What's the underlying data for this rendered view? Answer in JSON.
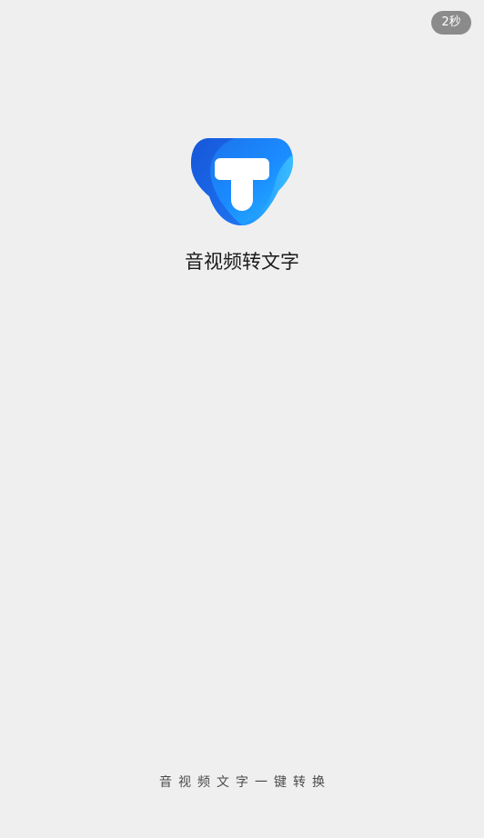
{
  "splash": {
    "skip_countdown": "2秒",
    "app_name": "音视频转文字",
    "slogan": "音视频文字一键转换",
    "logo_icon": "letter-t-logo-icon"
  },
  "colors": {
    "background": "#efefef",
    "badge_background": "#8b8b8b",
    "logo_blue": "#1a8cff",
    "logo_dark_blue": "#1554d6"
  }
}
